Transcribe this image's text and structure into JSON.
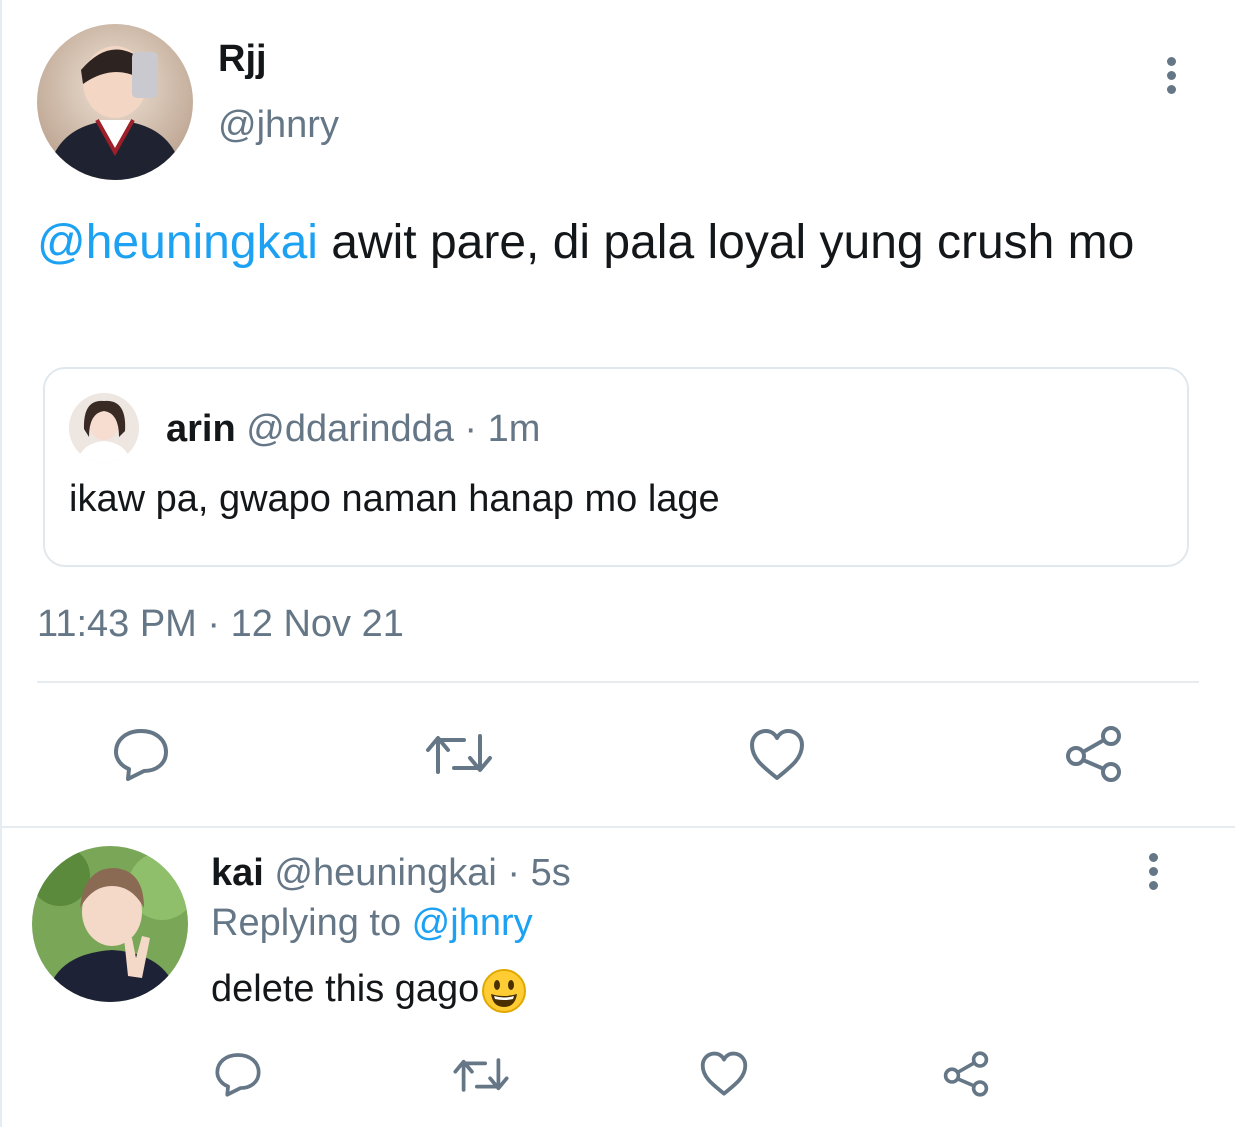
{
  "main_tweet": {
    "author_name": "Rjj",
    "author_handle": "@jhnry",
    "mention": "@heuningkai",
    "text": " awit pare, di pala loyal yung crush mo",
    "time": "11:43 PM",
    "date_sep": " · ",
    "date": "12 Nov 21",
    "quoted": {
      "author_name": "arin",
      "author_handle": "@ddarindda",
      "sep": " · ",
      "time": "1m",
      "text": "ikaw pa, gwapo naman hanap mo lage"
    }
  },
  "reply": {
    "author_name": "kai",
    "author_handle": "@heuningkai",
    "sep": " · ",
    "time": "5s",
    "replying_prefix": "Replying to ",
    "replying_handle": "@jhnry",
    "text": "delete this gago"
  },
  "icons": {
    "reply": "reply-icon",
    "retweet": "retweet-icon",
    "like": "heart-icon",
    "share": "share-icon",
    "more": "more-vertical-icon",
    "emoji": "grinning-face-emoji"
  },
  "colors": {
    "link": "#1da1f2",
    "muted": "#657786",
    "divider": "#e6ecf0",
    "text": "#14171a"
  }
}
